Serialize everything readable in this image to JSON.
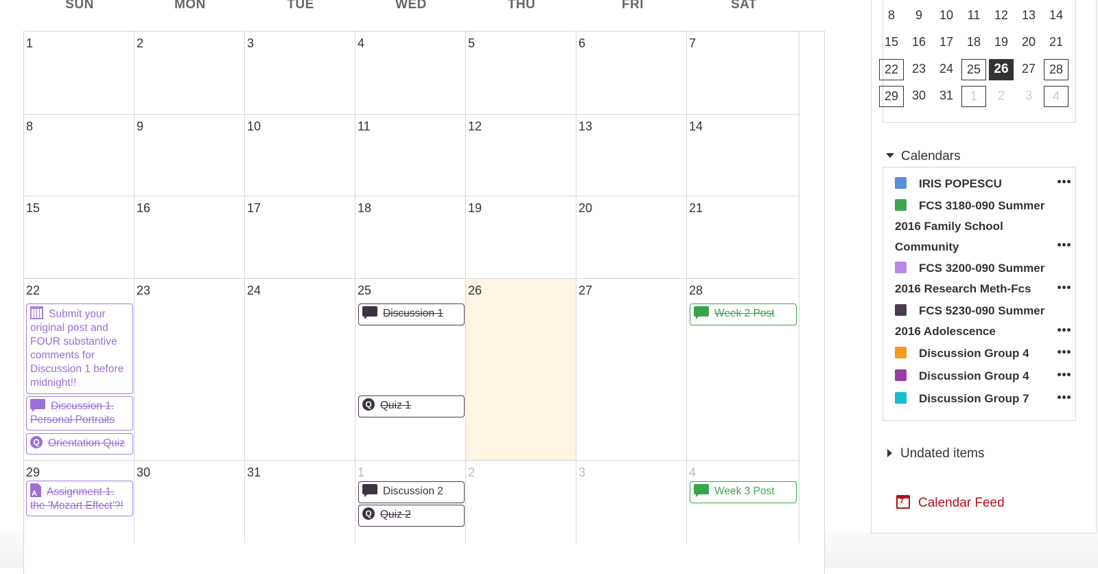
{
  "weekdays": [
    "SUN",
    "MON",
    "TUE",
    "WED",
    "THU",
    "FRI",
    "SAT"
  ],
  "weeks": [
    [
      "1",
      "2",
      "3",
      "4",
      "5",
      "6",
      "7"
    ],
    [
      "8",
      "9",
      "10",
      "11",
      "12",
      "13",
      "14"
    ],
    [
      "15",
      "16",
      "17",
      "18",
      "19",
      "20",
      "21"
    ],
    [
      "22",
      "23",
      "24",
      "25",
      "26",
      "27",
      "28"
    ],
    [
      "29",
      "30",
      "31",
      "1",
      "2",
      "3",
      "4"
    ]
  ],
  "events": {
    "submit_post": "Submit your original post and FOUR substantive comments for Discussion 1 before midnight!!",
    "discussion1_portraits": "Discussion 1. Personal Portraits",
    "orientation_quiz": "Orientation Quiz",
    "discussion1": "Discussion 1",
    "quiz1": "Quiz 1",
    "week2_post": "Week 2 Post",
    "assignment1": "Assignment 1. the 'Mozart Effect'?!",
    "discussion2": "Discussion 2",
    "quiz2": "Quiz 2",
    "week3_post": "Week 3 Post"
  },
  "mini_calendar": {
    "rows": [
      [
        "8",
        "9",
        "10",
        "11",
        "12",
        "13",
        "14"
      ],
      [
        "15",
        "16",
        "17",
        "18",
        "19",
        "20",
        "21"
      ],
      [
        "22",
        "23",
        "24",
        "25",
        "26",
        "27",
        "28"
      ],
      [
        "29",
        "30",
        "31",
        "1",
        "2",
        "3",
        "4"
      ]
    ],
    "today": "26"
  },
  "calendars": {
    "heading": "Calendars",
    "items": [
      {
        "line1": "IRIS POPESCU",
        "line2": "",
        "line3": "",
        "color": "#5b8fdd"
      },
      {
        "line1": "FCS 3180-090 Summer",
        "line2": "2016 Family School",
        "line3": "Community",
        "color": "#3ea64e"
      },
      {
        "line1": "FCS 3200-090 Summer",
        "line2": "2016 Research Meth-Fcs",
        "line3": "",
        "color": "#b88ae6"
      },
      {
        "line1": "FCS 5230-090 Summer",
        "line2": "2016 Adolescence",
        "line3": "",
        "color": "#4b3b4f"
      },
      {
        "line1": "Discussion Group 4",
        "line2": "",
        "line3": "",
        "color": "#f39a1f"
      },
      {
        "line1": "Discussion Group 4",
        "line2": "",
        "line3": "",
        "color": "#963fa3"
      },
      {
        "line1": "Discussion Group 7",
        "line2": "",
        "line3": "",
        "color": "#17bcd0"
      }
    ]
  },
  "undated": {
    "heading": "Undated items"
  },
  "feed": {
    "label": "Calendar Feed"
  }
}
